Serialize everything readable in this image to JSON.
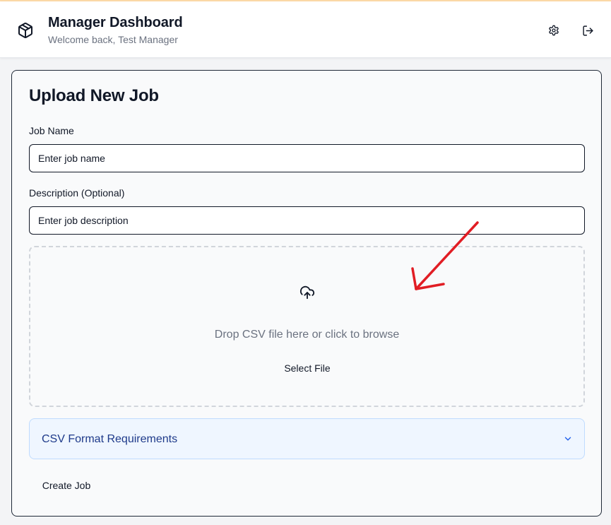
{
  "header": {
    "title": "Manager Dashboard",
    "subtitle": "Welcome back, Test Manager",
    "logo_icon": "package-icon",
    "settings_icon": "gear-icon",
    "logout_icon": "logout-icon"
  },
  "upload_form": {
    "title": "Upload New Job",
    "job_name": {
      "label": "Job Name",
      "placeholder": "Enter job name",
      "value": ""
    },
    "description": {
      "label": "Description (Optional)",
      "placeholder": "Enter job description",
      "value": ""
    },
    "dropzone": {
      "icon": "cloud-upload-icon",
      "text": "Drop CSV file here or click to browse",
      "button_label": "Select File"
    },
    "requirements": {
      "title": "CSV Format Requirements",
      "expanded": false,
      "icon": "chevron-down-icon"
    },
    "submit_label": "Create Job"
  },
  "annotation": {
    "type": "arrow",
    "color": "#e11d24"
  },
  "colors": {
    "accent_top_border": "#fdd9a6",
    "requirements_bg": "#eff6ff",
    "requirements_text": "#1e3a8a",
    "annotation_red": "#e11d24"
  }
}
